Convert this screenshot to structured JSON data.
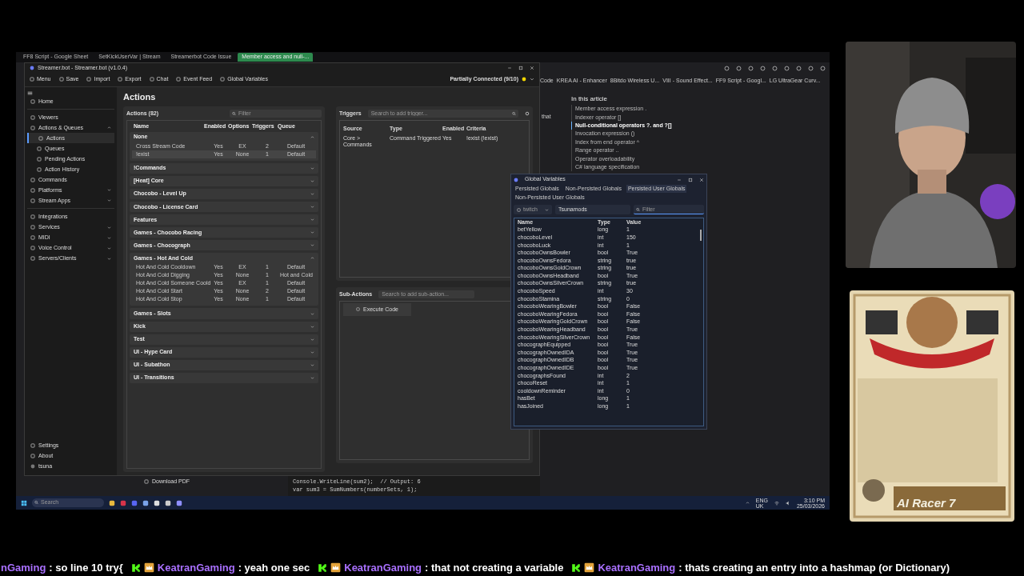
{
  "browser": {
    "tabs": [
      {
        "label": "FF8 Script - Google Sheet",
        "selected": false
      },
      {
        "label": "SetKickUserVar | Stream",
        "selected": false
      },
      {
        "label": "Streamerbot Code Issue",
        "selected": false
      },
      {
        "label": "Member access and null-...",
        "selected": true
      }
    ],
    "bookmarks": [
      "Code",
      "KREA AI - Enhancer",
      "8Bitdo Wireless U...",
      "VIII - Sound Effect...",
      "FF9 Script - Googl...",
      "LG UltraGear Curv..."
    ],
    "article_fragment": "that",
    "article": {
      "heading": "In this article",
      "items": [
        {
          "label": "Member access expression .",
          "selected": false
        },
        {
          "label": "Indexer operator []",
          "selected": false
        },
        {
          "label": "Null-conditional operators ?. and ?[]",
          "selected": true
        },
        {
          "label": "Invocation expression ()",
          "selected": false
        },
        {
          "label": "Index from end operator ^",
          "selected": false
        },
        {
          "label": "Range operator ..",
          "selected": false
        },
        {
          "label": "Operator overloadability",
          "selected": false
        },
        {
          "label": "C# language specification",
          "selected": false
        }
      ]
    },
    "download_pdf": "Download PDF",
    "code_lines": [
      "Console.WriteLine(sum2);  // Output: 6",
      "var sum3 = SumNumbers(numberSets, 1);"
    ]
  },
  "streamerbot": {
    "title": "Streamer.bot - Streamer.bot (v1.0.4)",
    "toolbar": [
      "Menu",
      "Save",
      "Import",
      "Export",
      "Chat",
      "Event Feed",
      "Global Variables"
    ],
    "status": "Partially Connected (9/10)",
    "sidebar": [
      [
        {
          "label": "Home",
          "selected": false
        }
      ],
      [
        {
          "label": "Viewers",
          "selected": false
        },
        {
          "label": "Actions & Queues",
          "expanded": true,
          "selected": false,
          "children": [
            {
              "label": "Actions",
              "selected": true
            },
            {
              "label": "Queues",
              "selected": false
            },
            {
              "label": "Pending Actions",
              "selected": false
            },
            {
              "label": "Action History",
              "selected": false
            }
          ]
        },
        {
          "label": "Commands",
          "selected": false
        },
        {
          "label": "Platforms",
          "expanded": false,
          "selected": false
        },
        {
          "label": "Stream Apps",
          "expanded": false,
          "selected": false
        }
      ],
      [
        {
          "label": "Integrations",
          "selected": false
        },
        {
          "label": "Services",
          "expanded": false,
          "selected": false
        },
        {
          "label": "MIDI",
          "expanded": false,
          "selected": false
        },
        {
          "label": "Voice Control",
          "expanded": false,
          "selected": false
        },
        {
          "label": "Servers/Clients",
          "expanded": false,
          "selected": false
        }
      ]
    ],
    "sidebar_bottom": [
      "Settings",
      "About"
    ],
    "user": "tsuna",
    "heading": "Actions",
    "actions": {
      "title": "Actions (82)",
      "filter_placeholder": "Filter",
      "columns": [
        "Name",
        "Enabled",
        "Options",
        "Triggers",
        "Queue"
      ],
      "groups": [
        {
          "name": "None",
          "expanded": true,
          "rows": [
            {
              "name": "Cross Stream Code",
              "enabled": "Yes",
              "options": "EX",
              "triggers": "2",
              "queue": "Default",
              "selected": false
            },
            {
              "name": "!exist",
              "enabled": "Yes",
              "options": "None",
              "triggers": "1",
              "queue": "Default",
              "selected": true
            }
          ]
        },
        {
          "name": "!Commands",
          "expanded": false
        },
        {
          "name": "[Heat] Core",
          "expanded": false
        },
        {
          "name": "Chocobo - Level Up",
          "expanded": false
        },
        {
          "name": "Chocobo - License Card",
          "expanded": false
        },
        {
          "name": "Features",
          "expanded": false
        },
        {
          "name": "Games - Chocobo Racing",
          "expanded": false
        },
        {
          "name": "Games - Chocograph",
          "expanded": false
        },
        {
          "name": "Games - Hot And Cold",
          "expanded": true,
          "rows": [
            {
              "name": "Hot And Cold Cooldown",
              "enabled": "Yes",
              "options": "EX",
              "triggers": "1",
              "queue": "Default",
              "selected": false
            },
            {
              "name": "Hot And Cold Digging",
              "enabled": "Yes",
              "options": "None",
              "triggers": "1",
              "queue": "Hot and Cold",
              "selected": false
            },
            {
              "name": "Hot And Cold Someone Coold",
              "enabled": "Yes",
              "options": "EX",
              "triggers": "1",
              "queue": "Default",
              "selected": false
            },
            {
              "name": "Hot And Cold Start",
              "enabled": "Yes",
              "options": "None",
              "triggers": "2",
              "queue": "Default",
              "selected": false
            },
            {
              "name": "Hot And Cold Stop",
              "enabled": "Yes",
              "options": "None",
              "triggers": "1",
              "queue": "Default",
              "selected": false
            }
          ]
        },
        {
          "name": "Games - Slots",
          "expanded": false
        },
        {
          "name": "Kick",
          "expanded": false
        },
        {
          "name": "Test",
          "expanded": false
        },
        {
          "name": "UI - Hype Card",
          "expanded": false
        },
        {
          "name": "UI - Subathon",
          "expanded": false
        },
        {
          "name": "UI - Transitions",
          "expanded": false
        }
      ]
    },
    "triggers": {
      "title": "Triggers",
      "placeholder": "Search to add trigger...",
      "columns": [
        "Source",
        "Type",
        "Enabled",
        "Criteria"
      ],
      "rows": [
        [
          "Core > Commands",
          "Command Triggered",
          "Yes",
          "!exist (!exist)"
        ]
      ]
    },
    "subactions": {
      "title": "Sub-Actions",
      "placeholder": "Search to add sub-action...",
      "items": [
        "Execute Code"
      ]
    }
  },
  "global_variables": {
    "title": "Global Variables",
    "tabs": [
      {
        "label": "Persisted Globals",
        "selected": false
      },
      {
        "label": "Non-Persisted Globals",
        "selected": false
      },
      {
        "label": "Persisted User Globals",
        "selected": true
      },
      {
        "label": "Non-Persisted User Globals",
        "selected": false
      }
    ],
    "platform": "twitch",
    "user": "Tsunamods",
    "filter_placeholder": "Filter",
    "columns": [
      "Name",
      "Type",
      "Value"
    ],
    "rows": [
      [
        "betYellow",
        "long",
        "1"
      ],
      [
        "chocoboLevel",
        "int",
        "150"
      ],
      [
        "chocoboLuck",
        "int",
        "1"
      ],
      [
        "chocoboOwnsBowler",
        "bool",
        "True"
      ],
      [
        "chocoboOwnsFedora",
        "string",
        "true"
      ],
      [
        "chocoboOwnsGoldCrown",
        "string",
        "true"
      ],
      [
        "chocoboOwnsHeadband",
        "bool",
        "True"
      ],
      [
        "chocoboOwnsSilverCrown",
        "string",
        "true"
      ],
      [
        "chocoboSpeed",
        "int",
        "30"
      ],
      [
        "chocoboStamina",
        "string",
        "0"
      ],
      [
        "chocoboWearingBowler",
        "bool",
        "False"
      ],
      [
        "chocoboWearingFedora",
        "bool",
        "False"
      ],
      [
        "chocoboWearingGoldCrown",
        "bool",
        "False"
      ],
      [
        "chocoboWearingHeadband",
        "bool",
        "True"
      ],
      [
        "chocoboWearingSilverCrown",
        "bool",
        "False"
      ],
      [
        "chocographEquipped",
        "bool",
        "True"
      ],
      [
        "chocographOwnedIDA",
        "bool",
        "True"
      ],
      [
        "chocographOwnedIDB",
        "bool",
        "True"
      ],
      [
        "chocographOwnedIDE",
        "bool",
        "True"
      ],
      [
        "chocographsFound",
        "int",
        "2"
      ],
      [
        "chocoReset",
        "int",
        "1"
      ],
      [
        "cooldownReminder",
        "int",
        "0"
      ],
      [
        "hasBet",
        "long",
        "1"
      ],
      [
        "hasJoined",
        "long",
        "1"
      ]
    ]
  },
  "taskbar": {
    "search_placeholder": "Search",
    "language": "ENG",
    "region": "UK",
    "time": "3:10 PM",
    "date": "25/03/2026"
  },
  "overlay": {
    "card_title": "AI Racer 7"
  },
  "chat": [
    {
      "user": "nGaming",
      "message": ": so line 10 try{",
      "badges": false
    },
    {
      "user": "KeatranGaming",
      "message": ": yeah one sec",
      "badges": true
    },
    {
      "user": "KeatranGaming",
      "message": ": that not creating a variable",
      "badges": true
    },
    {
      "user": "KeatranGaming",
      "message": ": thats creating an entry into a hashmap (or Dictionary)",
      "badges": true
    }
  ]
}
